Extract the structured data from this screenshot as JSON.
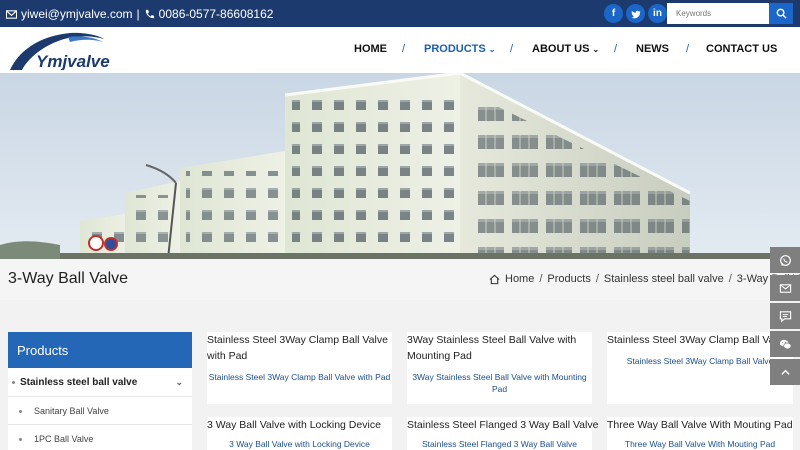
{
  "topbar": {
    "email": "yiwei@ymjvalve.com",
    "phone": "0086-0577-86608162",
    "social": [
      "f",
      "t",
      "in"
    ],
    "search_placeholder": "Keywords"
  },
  "logo": {
    "text": "Ymjvalve"
  },
  "nav": {
    "home": "HOME",
    "products": "PRODUCTS",
    "about": "ABOUT US",
    "news": "NEWS",
    "contact": "CONTACT US",
    "separator": "/"
  },
  "page": {
    "title": "3-Way Ball Valve",
    "breadcrumb": {
      "home": "Home",
      "products": "Products",
      "category": "Stainless steel ball valve",
      "current": "3-Way Ball V",
      "separator": "/"
    }
  },
  "sidebar": {
    "heading": "Products",
    "category": "Stainless steel ball valve",
    "items": [
      "Sanitary Ball Valve",
      "1PC Ball Valve"
    ]
  },
  "products": [
    {
      "title": "Stainless Steel 3Way Clamp Ball Valve with Pad",
      "desc": "Stainless Steel 3Way Clamp Ball Valve with Pad"
    },
    {
      "title": "3Way Stainless Steel Ball Valve with Mounting Pad",
      "desc": "3Way Stainless Steel Ball Valve with Mounting Pad"
    },
    {
      "title": "Stainless Steel 3Way Clamp Ball Valve",
      "desc": "Stainless Steel 3Way Clamp Ball Valve"
    },
    {
      "title": "3 Way Ball Valve with Locking Device",
      "desc": "3 Way Ball Valve with Locking Device"
    },
    {
      "title": "Stainless Steel Flanged 3 Way Ball Valve",
      "desc": "Stainless Steel Flanged 3 Way Ball Valve"
    },
    {
      "title": "Three Way Ball Valve With Mouting Pad",
      "desc": "Three Way Ball Valve With Mouting Pad"
    }
  ],
  "colors": {
    "topbar": "#1d3a6e",
    "accent": "#1b5fb0",
    "sidebar_head": "#2467b6",
    "float": "#7f7f7f"
  },
  "icons": [
    "mail-icon",
    "phone-icon",
    "facebook-icon",
    "twitter-icon",
    "linkedin-icon",
    "search-icon",
    "home-icon",
    "whatsapp-icon",
    "email-float-icon",
    "chat-icon",
    "wechat-icon",
    "back-to-top-icon"
  ]
}
